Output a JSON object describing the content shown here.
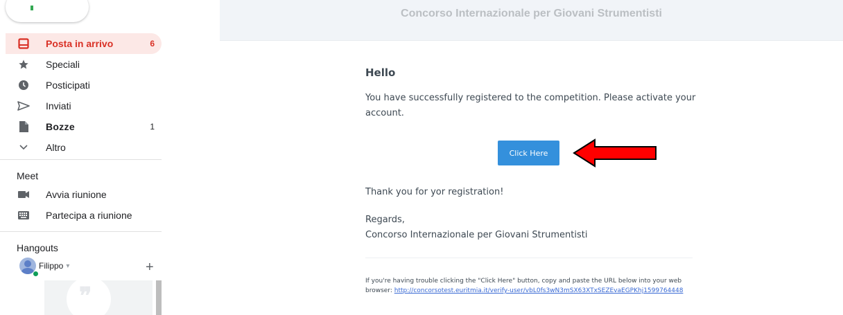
{
  "sidebar": {
    "items": [
      {
        "label": "Posta in arrivo",
        "count": "6",
        "icon": "inbox-icon"
      },
      {
        "label": "Speciali",
        "count": "",
        "icon": "star-icon"
      },
      {
        "label": "Posticipati",
        "count": "",
        "icon": "clock-icon"
      },
      {
        "label": "Inviati",
        "count": "",
        "icon": "send-icon"
      },
      {
        "label": "Bozze",
        "count": "1",
        "icon": "draft-icon"
      },
      {
        "label": "Altro",
        "count": "",
        "icon": "chevron-down-icon"
      }
    ],
    "meet": {
      "title": "Meet",
      "items": [
        {
          "label": "Avvia riunione",
          "icon": "video-icon"
        },
        {
          "label": "Partecipa a riunione",
          "icon": "keyboard-icon"
        }
      ]
    },
    "hangouts": {
      "title": "Hangouts",
      "user": "Filippo",
      "dropdown": "▾",
      "add": "+"
    }
  },
  "email": {
    "header_title": "Concorso Internazionale per Giovani Strumentisti",
    "greeting": "Hello",
    "line1": "You have successfully registered to the competition. Please activate your account.",
    "button_label": "Click Here",
    "thanks": "Thank you for yor registration!",
    "regards": "Regards,",
    "signature": "Concorso Internazionale per Giovani Strumentisti",
    "subcopy_text": "If you're having trouble clicking the \"Click Here\" button, copy and paste the URL below into your web browser: ",
    "subcopy_url": "http://concorsotest.euritmia.it/verify-user/vbL0fs3wN3mSX63XTxSEZEvaEGPKhj1599764448"
  },
  "colors": {
    "accent_red": "#d93025",
    "active_bg": "#fce8e6",
    "button_blue": "#3490dc",
    "arrow_red": "#ff0000",
    "online_green": "#0f9d58"
  }
}
